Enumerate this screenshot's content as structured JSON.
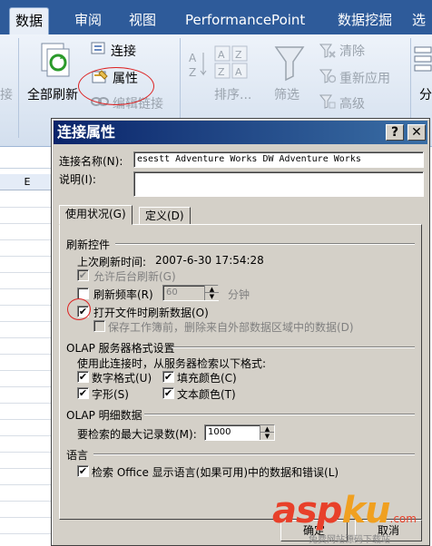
{
  "ribbon_tabs": [
    "数据",
    "审阅",
    "视图",
    "PerformancePoint",
    "数据挖掘",
    "选"
  ],
  "ribbon": {
    "left_partial": "接",
    "refresh_all": "全部刷新",
    "connections": "连接",
    "properties": "属性",
    "edit_links": "编辑链接",
    "sort": "排序...",
    "filter": "筛选",
    "clear": "清除",
    "reapply": "重新应用",
    "advanced": "高级",
    "right_partial": "分"
  },
  "sheet": {
    "column": "E"
  },
  "dialog": {
    "title": "连接属性",
    "help_btn": "?",
    "close_btn": "✕",
    "connection_name_label": "连接名称(N):",
    "connection_name_value": "esestt Adventure Works DW Adventure Works",
    "description_label": "说明(I):",
    "description_value": "",
    "tabs": [
      "使用状况(G)",
      "定义(D)"
    ],
    "refresh_section": "刷新控件",
    "last_refresh_label": "上次刷新时间:",
    "last_refresh_value": "2007-6-30   17:54:28",
    "bg_refresh": "允许后台刷新(G)",
    "refresh_every": "刷新频率(R)",
    "refresh_minutes": "60",
    "minutes_unit": "分钟",
    "refresh_on_open": "打开文件时刷新数据(O)",
    "remove_data": "保存工作簿前，删除来自外部数据区域中的数据(D)",
    "olap_format_section": "OLAP 服务器格式设置",
    "olap_format_desc": "使用此连接时，从服务器检索以下格式:",
    "number_format": "数字格式(U)",
    "fill_color": "填充颜色(C)",
    "font_style": "字形(S)",
    "text_color": "文本颜色(T)",
    "olap_drill_section": "OLAP 明细数据",
    "max_records_label": "要检索的最大记录数(M):",
    "max_records_value": "1000",
    "language_section": "语言",
    "language_option": "检索 Office 显示语言(如果可用)中的数据和错误(L)",
    "ok": "确定",
    "cancel": "取消"
  },
  "watermark": {
    "brand_a": "asp",
    "brand_b": "ku",
    "brand_c": ".com",
    "sub": "免费网站源码下载站"
  },
  "colors": {
    "ribbon_tab_bar": "#2e5b9a",
    "dialog_title": "#0a246a",
    "annotation": "#dd2222"
  }
}
